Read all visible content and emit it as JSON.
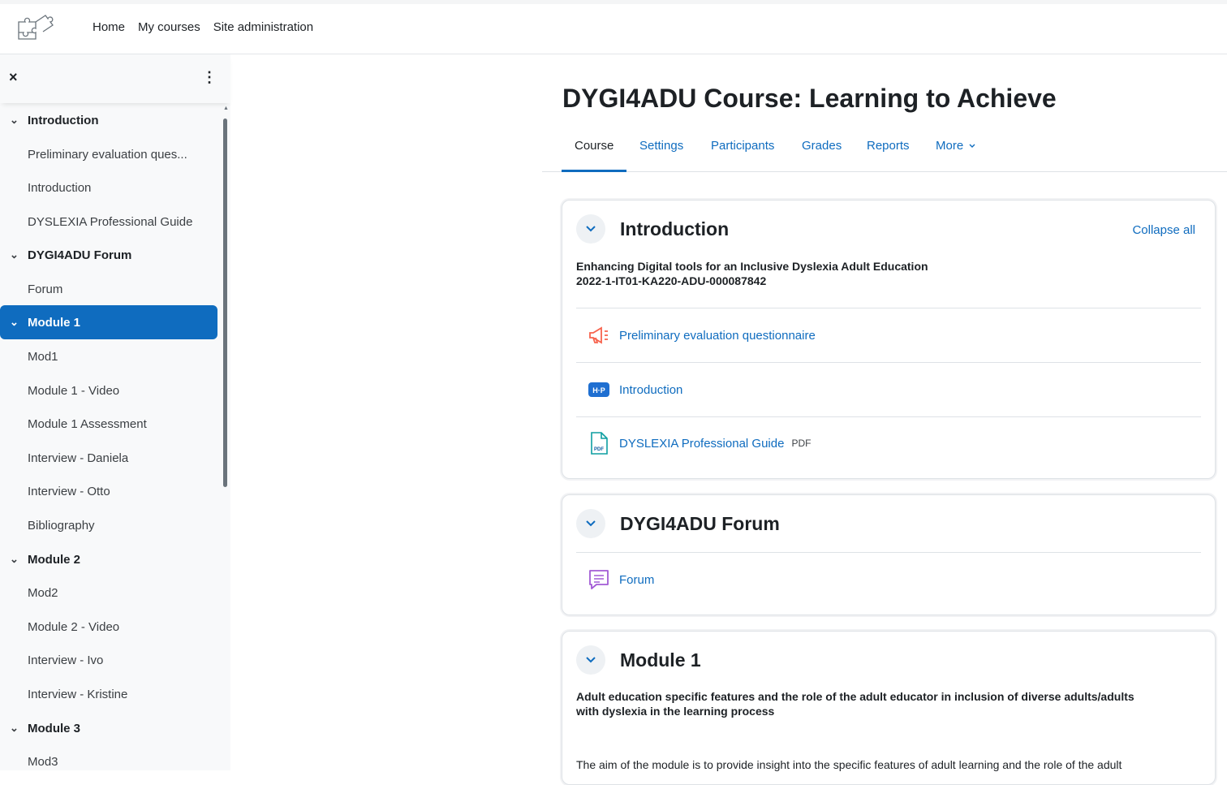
{
  "nav": {
    "links": [
      "Home",
      "My courses",
      "Site administration"
    ]
  },
  "drawer": {
    "close_icon": "×",
    "menu_icon": "⋮",
    "items": [
      {
        "type": "section",
        "label": "Introduction",
        "active": false
      },
      {
        "type": "activity",
        "label": "Preliminary evaluation ques..."
      },
      {
        "type": "activity",
        "label": "Introduction"
      },
      {
        "type": "activity",
        "label": "DYSLEXIA Professional Guide"
      },
      {
        "type": "section",
        "label": "DYGI4ADU Forum",
        "active": false
      },
      {
        "type": "activity",
        "label": "Forum"
      },
      {
        "type": "section",
        "label": "Module 1",
        "active": true
      },
      {
        "type": "activity",
        "label": "Mod1"
      },
      {
        "type": "activity",
        "label": "Module 1 - Video"
      },
      {
        "type": "activity",
        "label": "Module 1 Assessment"
      },
      {
        "type": "activity",
        "label": "Interview - Daniela"
      },
      {
        "type": "activity",
        "label": "Interview - Otto"
      },
      {
        "type": "activity",
        "label": "Bibliography"
      },
      {
        "type": "section",
        "label": "Module 2",
        "active": false
      },
      {
        "type": "activity",
        "label": "Mod2"
      },
      {
        "type": "activity",
        "label": "Module 2 - Video"
      },
      {
        "type": "activity",
        "label": "Interview - Ivo"
      },
      {
        "type": "activity",
        "label": "Interview - Kristine"
      },
      {
        "type": "section",
        "label": "Module 3",
        "active": false
      },
      {
        "type": "activity",
        "label": "Mod3"
      }
    ]
  },
  "main": {
    "title": "DYGI4ADU Course: Learning to Achieve",
    "tabs": [
      "Course",
      "Settings",
      "Participants",
      "Grades",
      "Reports",
      "More"
    ],
    "active_tab": "Course",
    "collapse_all": "Collapse all",
    "sections": {
      "intro": {
        "title": "Introduction",
        "summary_line1": "Enhancing Digital tools for an Inclusive Dyslexia Adult Education",
        "summary_line2": "2022-1-IT01-KA220-ADU-000087842",
        "activities": [
          {
            "icon": "feedback-megaphone-icon",
            "label": "Preliminary evaluation questionnaire",
            "badge": ""
          },
          {
            "icon": "h5p-icon",
            "label": "Introduction",
            "badge": ""
          },
          {
            "icon": "pdf-file-icon",
            "label": "DYSLEXIA Professional Guide",
            "badge": "PDF"
          }
        ]
      },
      "forum": {
        "title": "DYGI4ADU Forum",
        "activities": [
          {
            "icon": "forum-icon",
            "label": "Forum"
          }
        ]
      },
      "module1": {
        "title": "Module 1",
        "summary_line1": "Adult education specific features and the role of the adult educator in inclusion of diverse adults/adults",
        "summary_line2": "with dyslexia in the learning process",
        "text": "The aim of the module is to provide insight into the specific features of adult learning and the role of the adult"
      }
    }
  },
  "colors": {
    "accent": "#0f6cbf",
    "feedback_icon": "#f7634d",
    "h5p_icon": "#399be2",
    "pdf_icon": "#0d5ca1",
    "forum_icon": "#a25bd5"
  }
}
